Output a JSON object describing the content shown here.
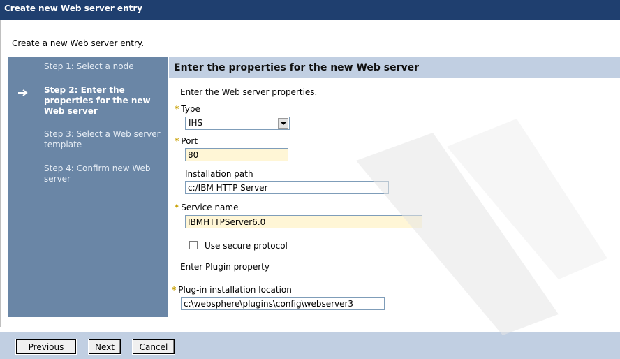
{
  "window": {
    "title": "Create new Web server entry"
  },
  "intro_text": "Create a new Web server entry.",
  "steps": [
    {
      "label": "Step 1: Select a node",
      "current": false
    },
    {
      "label": "Step 2: Enter the properties for the new Web server",
      "current": true
    },
    {
      "label": "Step 3: Select a Web server template",
      "current": false
    },
    {
      "label": "Step 4: Confirm new Web server",
      "current": false
    }
  ],
  "content": {
    "heading": "Enter the properties for the new Web server",
    "subheading": "Enter the Web server properties.",
    "type": {
      "label": "Type",
      "value": "IHS",
      "required": true
    },
    "port": {
      "label": "Port",
      "value": "80",
      "required": true
    },
    "install_path": {
      "label": "Installation path",
      "value": "c:/IBM HTTP Server"
    },
    "service_name": {
      "label": "Service name",
      "value": "IBMHTTPServer6.0",
      "required": true
    },
    "secure_protocol": {
      "label": "Use secure protocol",
      "checked": false
    },
    "plugin_section": "Enter Plugin property",
    "plugin_location": {
      "label": "Plug-in installation location",
      "value": "c:\\websphere\\plugins\\config\\webserver3",
      "required": true
    }
  },
  "buttons": {
    "previous": "Previous",
    "next": "Next",
    "cancel": "Cancel"
  },
  "colors": {
    "title_bar": "#1f3f6f",
    "steps_panel": "#6a86a6",
    "header_band": "#c1cfe2",
    "required_star": "#c8a000",
    "required_field": "#fff6d6"
  }
}
